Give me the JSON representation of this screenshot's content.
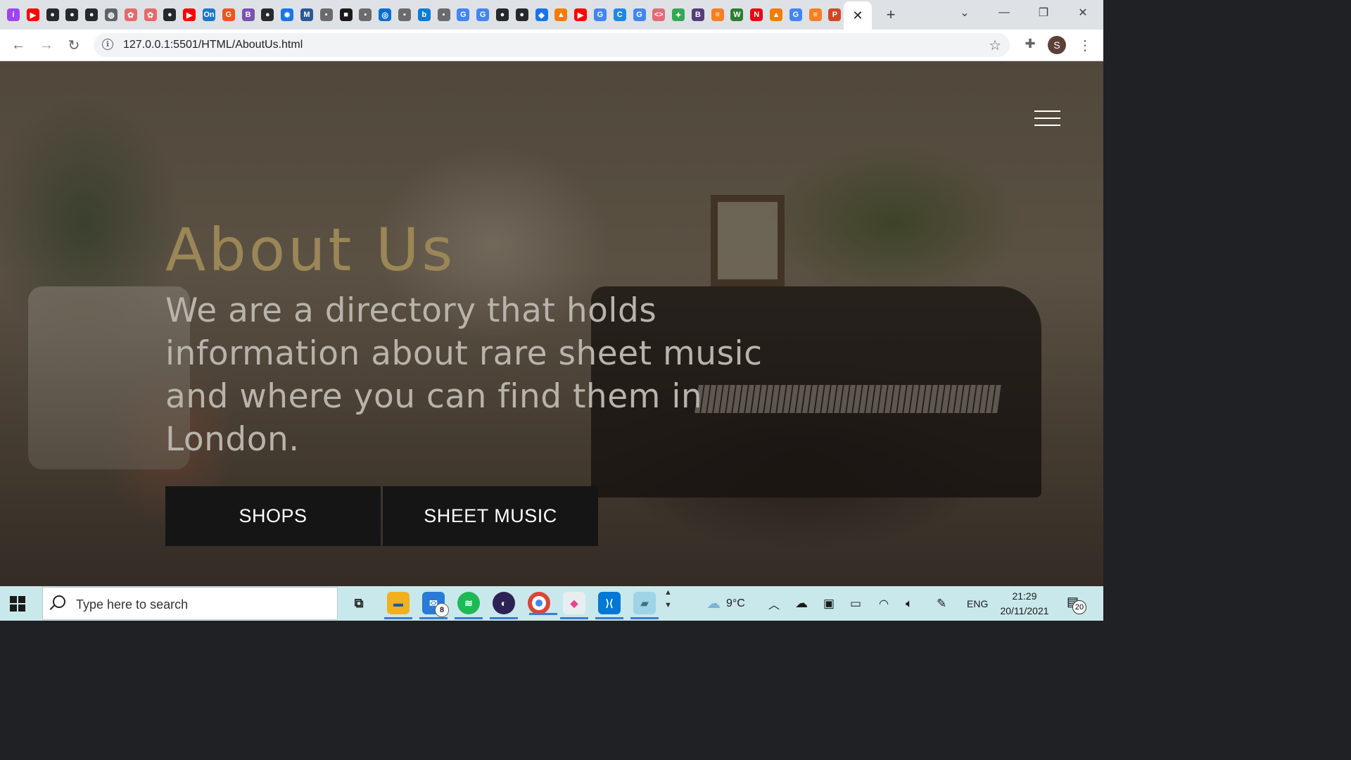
{
  "browser": {
    "tab_icons": [
      {
        "name": "tab-icon-1",
        "color": "#a142f4",
        "glyph": "i"
      },
      {
        "name": "youtube-icon",
        "color": "#ff0000",
        "glyph": "▶"
      },
      {
        "name": "github-icon",
        "color": "#24292e",
        "glyph": "●"
      },
      {
        "name": "github-icon",
        "color": "#24292e",
        "glyph": "●"
      },
      {
        "name": "github-icon",
        "color": "#24292e",
        "glyph": "●"
      },
      {
        "name": "globe-icon",
        "color": "#5f6368",
        "glyph": "◍"
      },
      {
        "name": "openai-icon",
        "color": "#e46a6a",
        "glyph": "✿"
      },
      {
        "name": "openai-icon",
        "color": "#e46a6a",
        "glyph": "✿"
      },
      {
        "name": "github-icon",
        "color": "#24292e",
        "glyph": "●"
      },
      {
        "name": "youtube-icon",
        "color": "#ff0000",
        "glyph": "▶"
      },
      {
        "name": "onshape-icon",
        "color": "#1b78c8",
        "glyph": "On"
      },
      {
        "name": "g-icon",
        "color": "#f4511e",
        "glyph": "G"
      },
      {
        "name": "bootstrap-icon",
        "color": "#7952b3",
        "glyph": "B"
      },
      {
        "name": "github-icon",
        "color": "#24292e",
        "glyph": "●"
      },
      {
        "name": "gear-icon",
        "color": "#1a73e8",
        "glyph": "✹"
      },
      {
        "name": "mvn-icon",
        "color": "#2b5797",
        "glyph": "M"
      },
      {
        "name": "dots-icon",
        "color": "#6b6b6b",
        "glyph": "▪"
      },
      {
        "name": "square-icon",
        "color": "#1a1a1a",
        "glyph": "■"
      },
      {
        "name": "dots-icon",
        "color": "#6b6b6b",
        "glyph": "▪"
      },
      {
        "name": "azure-icon",
        "color": "#0a6ed1",
        "glyph": "◎"
      },
      {
        "name": "dots-icon",
        "color": "#6b6b6b",
        "glyph": "▪"
      },
      {
        "name": "bing-icon",
        "color": "#0c7cd5",
        "glyph": "b"
      },
      {
        "name": "dots-icon",
        "color": "#6b6b6b",
        "glyph": "▪"
      },
      {
        "name": "google-icon",
        "color": "#4285f4",
        "glyph": "G"
      },
      {
        "name": "google-icon",
        "color": "#4285f4",
        "glyph": "G"
      },
      {
        "name": "github-icon",
        "color": "#24292e",
        "glyph": "●"
      },
      {
        "name": "github-icon",
        "color": "#24292e",
        "glyph": "●"
      },
      {
        "name": "diamond-icon",
        "color": "#1a73e8",
        "glyph": "◆"
      },
      {
        "name": "app-icon",
        "color": "#f57c00",
        "glyph": "▲"
      },
      {
        "name": "youtube-icon",
        "color": "#ff0000",
        "glyph": "▶"
      },
      {
        "name": "google-icon",
        "color": "#4285f4",
        "glyph": "G"
      },
      {
        "name": "c-icon",
        "color": "#1e88e5",
        "glyph": "C"
      },
      {
        "name": "google-icon",
        "color": "#4285f4",
        "glyph": "G"
      },
      {
        "name": "code-icon",
        "color": "#e06c75",
        "glyph": "<>"
      },
      {
        "name": "colorful-icon",
        "color": "#34a853",
        "glyph": "✦"
      },
      {
        "name": "bootstrap-icon",
        "color": "#563d7c",
        "glyph": "B"
      },
      {
        "name": "stack-icon",
        "color": "#f48024",
        "glyph": "≡"
      },
      {
        "name": "w-icon",
        "color": "#2e7d32",
        "glyph": "W"
      },
      {
        "name": "netflix-icon",
        "color": "#e50914",
        "glyph": "N"
      },
      {
        "name": "app-icon",
        "color": "#f57c00",
        "glyph": "▲"
      },
      {
        "name": "google-icon",
        "color": "#4285f4",
        "glyph": "G"
      },
      {
        "name": "stack-icon",
        "color": "#f48024",
        "glyph": "≡"
      },
      {
        "name": "powerpoint-icon",
        "color": "#d24726",
        "glyph": "P"
      }
    ],
    "active_tab_close": "✕",
    "new_tab": "+",
    "url": "127.0.0.1:5501/HTML/AboutUs.html",
    "profile_initial": "S"
  },
  "page": {
    "title": "About Us",
    "description": "We are a directory that holds information about rare sheet music and where you can find them in London.",
    "buttons": {
      "shops": "SHOPS",
      "sheet_music": "SHEET MUSIC"
    },
    "title_color": "#9b8657"
  },
  "taskbar": {
    "search_placeholder": "Type here to search",
    "mail_badge": "8",
    "weather": "9°C",
    "language": "ENG",
    "time": "21:29",
    "date": "20/11/2021",
    "notifications": "20"
  }
}
